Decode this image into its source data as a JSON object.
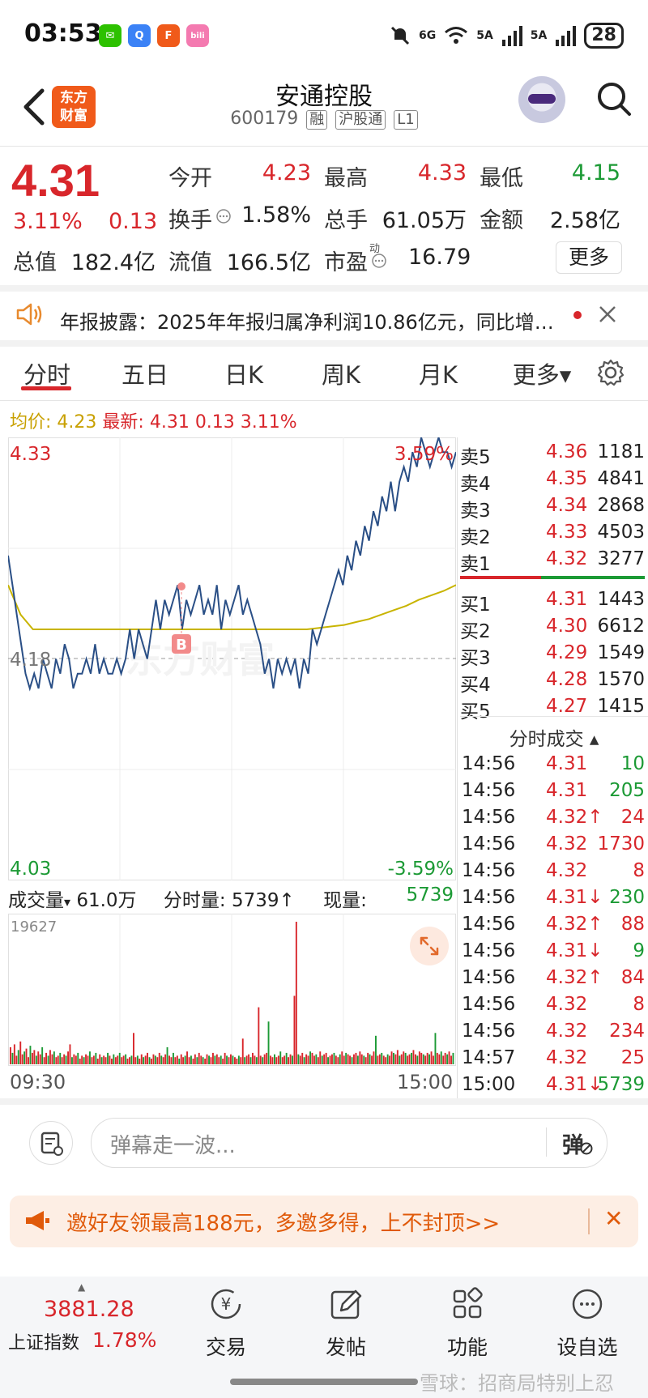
{
  "status_bar": {
    "time": "03:53",
    "apps": [
      {
        "icon": "wechat-icon",
        "color": "#2dc100",
        "glyph": "✉"
      },
      {
        "icon": "browser-icon",
        "color": "#3b82f6",
        "glyph": "Q"
      },
      {
        "icon": "eastmoney-app-icon",
        "color": "#f05a1a",
        "glyph": "F"
      },
      {
        "icon": "bilibili-icon",
        "color": "#f47ab0",
        "glyph": "bili"
      }
    ],
    "signal_1": "6G",
    "signal_2": "5A",
    "signal_3": "5A",
    "battery": "28"
  },
  "header": {
    "logo_line1": "东方",
    "logo_line2": "财富",
    "title": "安通控股",
    "code": "600179",
    "tags": [
      "融",
      "沪股通",
      "L1"
    ]
  },
  "quote": {
    "price": "4.31",
    "change_pct": "3.11%",
    "change_val": "0.13",
    "rows": [
      [
        {
          "label": "今开",
          "value": "4.23",
          "color": "red"
        },
        {
          "label": "最高",
          "value": "4.33",
          "color": "red"
        },
        {
          "label": "最低",
          "value": "4.15",
          "color": "green"
        }
      ],
      [
        {
          "label": "换手",
          "value": "1.58%",
          "color": "dark",
          "info": true
        },
        {
          "label": "总手",
          "value": "61.05万",
          "color": "dark"
        },
        {
          "label": "金额",
          "value": "2.58亿",
          "color": "dark"
        }
      ],
      [
        {
          "label": "总值",
          "value": "182.4亿",
          "color": "dark"
        },
        {
          "label": "流值",
          "value": "166.5亿",
          "color": "dark"
        },
        {
          "label": "市盈",
          "value": "16.79",
          "color": "dark",
          "super": "动",
          "info": true
        }
      ]
    ],
    "more": "更多"
  },
  "notice": {
    "text": "年报披露：2025年年报归属净利润10.86亿元，同比增…"
  },
  "tabs": [
    "分时",
    "五日",
    "日K",
    "周K",
    "月K",
    "更多▾"
  ],
  "info_line": {
    "avg_label": "均价:",
    "avg_value": "4.23",
    "latest_label": "最新:",
    "latest_value": "4.31",
    "latest_change": "0.13",
    "latest_pct": "3.11%"
  },
  "chart_data": {
    "type": "line",
    "y_top": "4.33",
    "y_bottom": "4.03",
    "y_mid": "4.18",
    "pct_top": "3.59%",
    "pct_bottom": "-3.59%",
    "ylim": [
      4.03,
      4.33
    ],
    "prev_close": 4.18,
    "marker": "B",
    "watermark": "东方财富",
    "price_series": [
      4.25,
      4.23,
      4.21,
      4.19,
      4.17,
      4.16,
      4.17,
      4.16,
      4.18,
      4.17,
      4.16,
      4.18,
      4.17,
      4.19,
      4.18,
      4.16,
      4.17,
      4.17,
      4.18,
      4.17,
      4.19,
      4.17,
      4.18,
      4.17,
      4.17,
      4.18,
      4.17,
      4.18,
      4.2,
      4.18,
      4.2,
      4.19,
      4.18,
      4.2,
      4.22,
      4.2,
      4.22,
      4.21,
      4.22,
      4.23,
      4.2,
      4.22,
      4.21,
      4.22,
      4.23,
      4.21,
      4.22,
      4.21,
      4.23,
      4.2,
      4.22,
      4.21,
      4.22,
      4.23,
      4.21,
      4.22,
      4.21,
      4.2,
      4.19,
      4.17,
      4.18,
      4.16,
      4.18,
      4.17,
      4.18,
      4.17,
      4.18,
      4.16,
      4.18,
      4.17,
      4.2,
      4.19,
      4.2,
      4.21,
      4.22,
      4.23,
      4.24,
      4.23,
      4.25,
      4.24,
      4.26,
      4.25,
      4.27,
      4.26,
      4.28,
      4.27,
      4.29,
      4.28,
      4.3,
      4.28,
      4.3,
      4.31,
      4.3,
      4.32,
      4.31,
      4.33,
      4.32,
      4.31,
      4.32,
      4.33,
      4.32,
      4.32,
      4.31,
      4.32
    ],
    "avg_series": [
      4.23,
      4.21,
      4.2,
      4.2,
      4.2,
      4.2,
      4.2,
      4.2,
      4.2,
      4.2,
      4.2,
      4.2,
      4.2,
      4.2,
      4.2,
      4.2,
      4.2,
      4.2,
      4.2,
      4.2,
      4.2,
      4.2,
      4.2,
      4.2,
      4.2,
      4.201,
      4.202,
      4.203,
      4.205,
      4.207,
      4.21,
      4.213,
      4.216,
      4.22,
      4.223,
      4.226,
      4.23
    ],
    "volume_max_label": "19627",
    "volumes": [
      12,
      8,
      14,
      6,
      10,
      16,
      7,
      9,
      11,
      5,
      13,
      8,
      10,
      6,
      9,
      7,
      12,
      5,
      8,
      6,
      10,
      7,
      9,
      5,
      6,
      8,
      5,
      7,
      6,
      9,
      14,
      5,
      7,
      6,
      8,
      4,
      6,
      5,
      7,
      6,
      9,
      5,
      6,
      8,
      4,
      7,
      5,
      6,
      5,
      8,
      6,
      4,
      7,
      5,
      6,
      8,
      5,
      6,
      7,
      4,
      5,
      6,
      22,
      5,
      6,
      4,
      7,
      5,
      6,
      8,
      5,
      4,
      7,
      6,
      5,
      8,
      6,
      5,
      7,
      12,
      6,
      5,
      8,
      5,
      6,
      4,
      7,
      5,
      6,
      9,
      5,
      6,
      4,
      7,
      5,
      8,
      6,
      5,
      4,
      7,
      6,
      5,
      8,
      6,
      7,
      5,
      6,
      4,
      8,
      6,
      5,
      7,
      6,
      5,
      4,
      6,
      5,
      18,
      5,
      6,
      7,
      5,
      8,
      6,
      5,
      40,
      6,
      5,
      7,
      8,
      30,
      6,
      5,
      7,
      5,
      6,
      9,
      5,
      6,
      8,
      5,
      7,
      6,
      48,
      100,
      7,
      6,
      8,
      5,
      7,
      6,
      9,
      8,
      6,
      7,
      5,
      9,
      6,
      7,
      8,
      5,
      6,
      7,
      8,
      6,
      5,
      7,
      9,
      6,
      8,
      7,
      6,
      5,
      7,
      8,
      6,
      9,
      7,
      6,
      5,
      8,
      7,
      6,
      9,
      20,
      6,
      7,
      8,
      6,
      5,
      7,
      6,
      9,
      8,
      7,
      10,
      6,
      7,
      9,
      8,
      6,
      7,
      8,
      10,
      7,
      6,
      9,
      8,
      7,
      6,
      8,
      7,
      9,
      6,
      22,
      8,
      7,
      9,
      6,
      8,
      7,
      9,
      6,
      8
    ],
    "xticks": [
      "09:30",
      "15:00"
    ]
  },
  "volume_bar": {
    "label": "成交量",
    "total": "61.0万",
    "minute_label": "分时量:",
    "minute_value": "5739↑",
    "now_label": "现量:",
    "now_value": "5739"
  },
  "order_book": {
    "asks": [
      {
        "label": "卖5",
        "price": "4.36",
        "vol": "1181"
      },
      {
        "label": "卖4",
        "price": "4.35",
        "vol": "4841"
      },
      {
        "label": "卖3",
        "price": "4.34",
        "vol": "2868"
      },
      {
        "label": "卖2",
        "price": "4.33",
        "vol": "4503"
      },
      {
        "label": "卖1",
        "price": "4.32",
        "vol": "3277"
      }
    ],
    "bids": [
      {
        "label": "买1",
        "price": "4.31",
        "vol": "1443"
      },
      {
        "label": "买2",
        "price": "4.30",
        "vol": "6612"
      },
      {
        "label": "买3",
        "price": "4.29",
        "vol": "1549"
      },
      {
        "label": "买4",
        "price": "4.28",
        "vol": "1570"
      },
      {
        "label": "买5",
        "price": "4.27",
        "vol": "1415"
      }
    ]
  },
  "ticks": {
    "title": "分时成交 ▴",
    "rows": [
      {
        "time": "14:56",
        "price": "4.31",
        "vol": "10",
        "color": "green"
      },
      {
        "time": "14:56",
        "price": "4.31",
        "vol": "205",
        "color": "green"
      },
      {
        "time": "14:56",
        "price": "4.32↑",
        "vol": "24",
        "color": "red"
      },
      {
        "time": "14:56",
        "price": "4.32",
        "vol": "1730",
        "color": "red"
      },
      {
        "time": "14:56",
        "price": "4.32",
        "vol": "8",
        "color": "red"
      },
      {
        "time": "14:56",
        "price": "4.31↓",
        "vol": "230",
        "color": "green"
      },
      {
        "time": "14:56",
        "price": "4.32↑",
        "vol": "88",
        "color": "red"
      },
      {
        "time": "14:56",
        "price": "4.31↓",
        "vol": "9",
        "color": "green"
      },
      {
        "time": "14:56",
        "price": "4.32↑",
        "vol": "84",
        "color": "red"
      },
      {
        "time": "14:56",
        "price": "4.32",
        "vol": "8",
        "color": "red"
      },
      {
        "time": "14:56",
        "price": "4.32",
        "vol": "234",
        "color": "red"
      },
      {
        "time": "14:57",
        "price": "4.32",
        "vol": "25",
        "color": "red"
      },
      {
        "time": "15:00",
        "price": "4.31↓",
        "vol": "5739",
        "color": "green"
      }
    ]
  },
  "danmaku": {
    "placeholder": "弹幕走一波...",
    "button": "弹"
  },
  "promo": {
    "text": "邀好友领最高188元，多邀多得，上不封顶>>",
    "close": "✕"
  },
  "bottom_nav": {
    "index_value": "3881.28",
    "index_name": "上证指数",
    "index_pct": "1.78%",
    "items": [
      {
        "label": "交易",
        "icon": "trade-icon"
      },
      {
        "label": "发帖",
        "icon": "post-icon"
      },
      {
        "label": "功能",
        "icon": "functions-icon"
      },
      {
        "label": "设自选",
        "icon": "add-watchlist-icon"
      }
    ],
    "watermark": "雪球：招商局特别上忍"
  },
  "colors": {
    "red": "#d8262b",
    "green": "#1c9a35",
    "avg_line": "#c8b400",
    "price_line": "#2a4f86",
    "accent": "#f05a1a"
  }
}
